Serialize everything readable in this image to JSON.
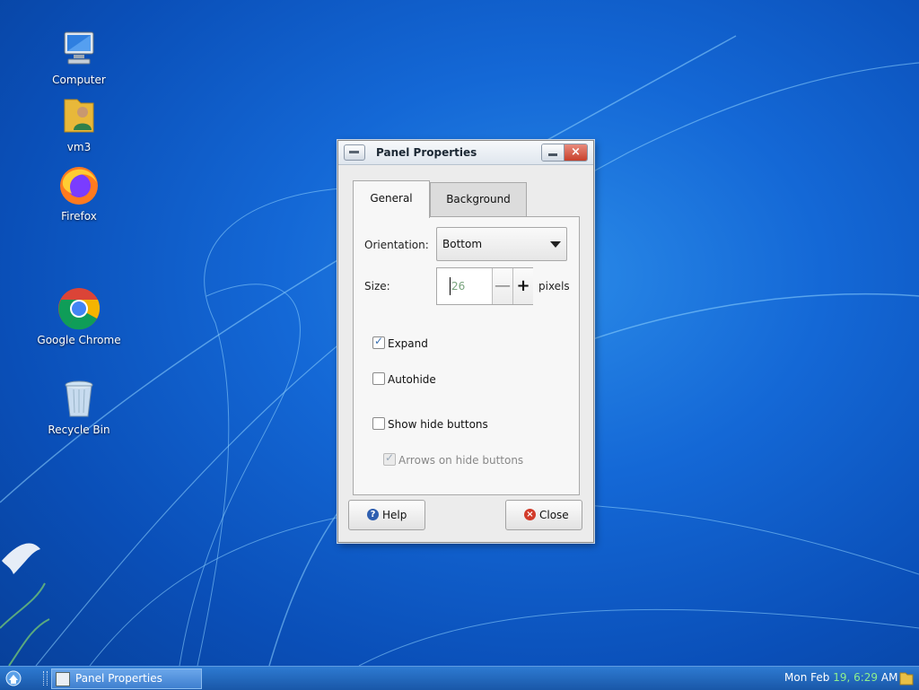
{
  "desktop": {
    "icons": [
      {
        "label": "Computer"
      },
      {
        "label": "vm3"
      },
      {
        "label": "Firefox"
      },
      {
        "label": "Google Chrome"
      },
      {
        "label": "Recycle Bin"
      }
    ]
  },
  "dialog": {
    "title": "Panel Properties",
    "close_glyph": "×",
    "tabs": [
      {
        "label": "General",
        "active": true
      },
      {
        "label": "Background",
        "active": false
      }
    ],
    "orientation": {
      "label": "Orientation:",
      "value": "Bottom"
    },
    "size": {
      "label": "Size:",
      "value": "26",
      "unit": "pixels",
      "minus": "—",
      "plus": "+"
    },
    "checkboxes": [
      {
        "label": "Expand",
        "checked": true,
        "enabled": true
      },
      {
        "label": "Autohide",
        "checked": false,
        "enabled": true
      },
      {
        "label": "Show hide buttons",
        "checked": false,
        "enabled": true
      },
      {
        "label": "Arrows on hide buttons",
        "checked": true,
        "enabled": false
      }
    ],
    "help_label": "Help",
    "close_label": "Close"
  },
  "taskbar": {
    "task_label": "Panel Properties",
    "clock": {
      "day": "Mon Feb ",
      "date": "19,",
      "space": " ",
      "time": "6:29",
      "ampm": " AM"
    }
  },
  "colors": {
    "desktop": "#1468d6",
    "taskbar": "#1957a8",
    "close_red": "#c8402b"
  }
}
